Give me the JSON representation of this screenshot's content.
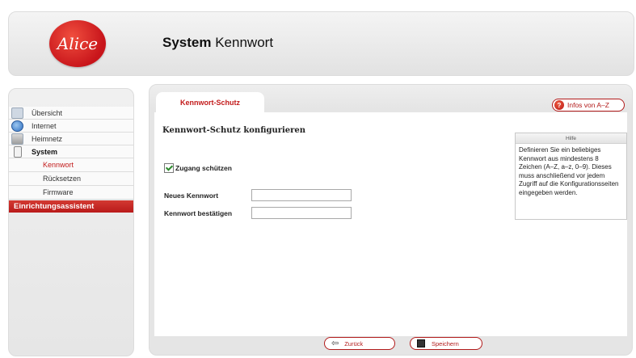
{
  "brand": {
    "logo_text": "Alice",
    "accent": "#c21a1a"
  },
  "header": {
    "title_bold": "System",
    "title_rest": "Kennwort"
  },
  "sidebar": {
    "items": [
      {
        "label": "Übersicht",
        "icon": "home-icon"
      },
      {
        "label": "Internet",
        "icon": "globe-icon"
      },
      {
        "label": "Heimnetz",
        "icon": "network-icon"
      },
      {
        "label": "System",
        "icon": "system-icon"
      }
    ],
    "subitems": [
      {
        "label": "Kennwort"
      },
      {
        "label": "Rücksetzen"
      },
      {
        "label": "Firmware"
      }
    ],
    "wizard_label": "Einrichtungsassistent"
  },
  "main": {
    "tab_label": "Kennwort-Schutz",
    "info_label": "Infos von A–Z",
    "section_title": "Kennwort-Schutz konfigurieren",
    "checkbox_label": "Zugang schützen",
    "new_password_label": "Neues Kennwort",
    "confirm_password_label": "Kennwort bestätigen",
    "new_password_value": "",
    "confirm_password_value": ""
  },
  "help": {
    "title": "Hilfe",
    "text": "Definieren Sie ein beliebiges Kennwort aus mindestens 8 Zeichen (A–Z, a–z, 0–9). Dieses muss anschließend vor jedem Zugriff auf die Konfigurationsseiten eingegeben werden."
  },
  "footer": {
    "back_label": "Zurück",
    "save_label": "Speichern"
  }
}
